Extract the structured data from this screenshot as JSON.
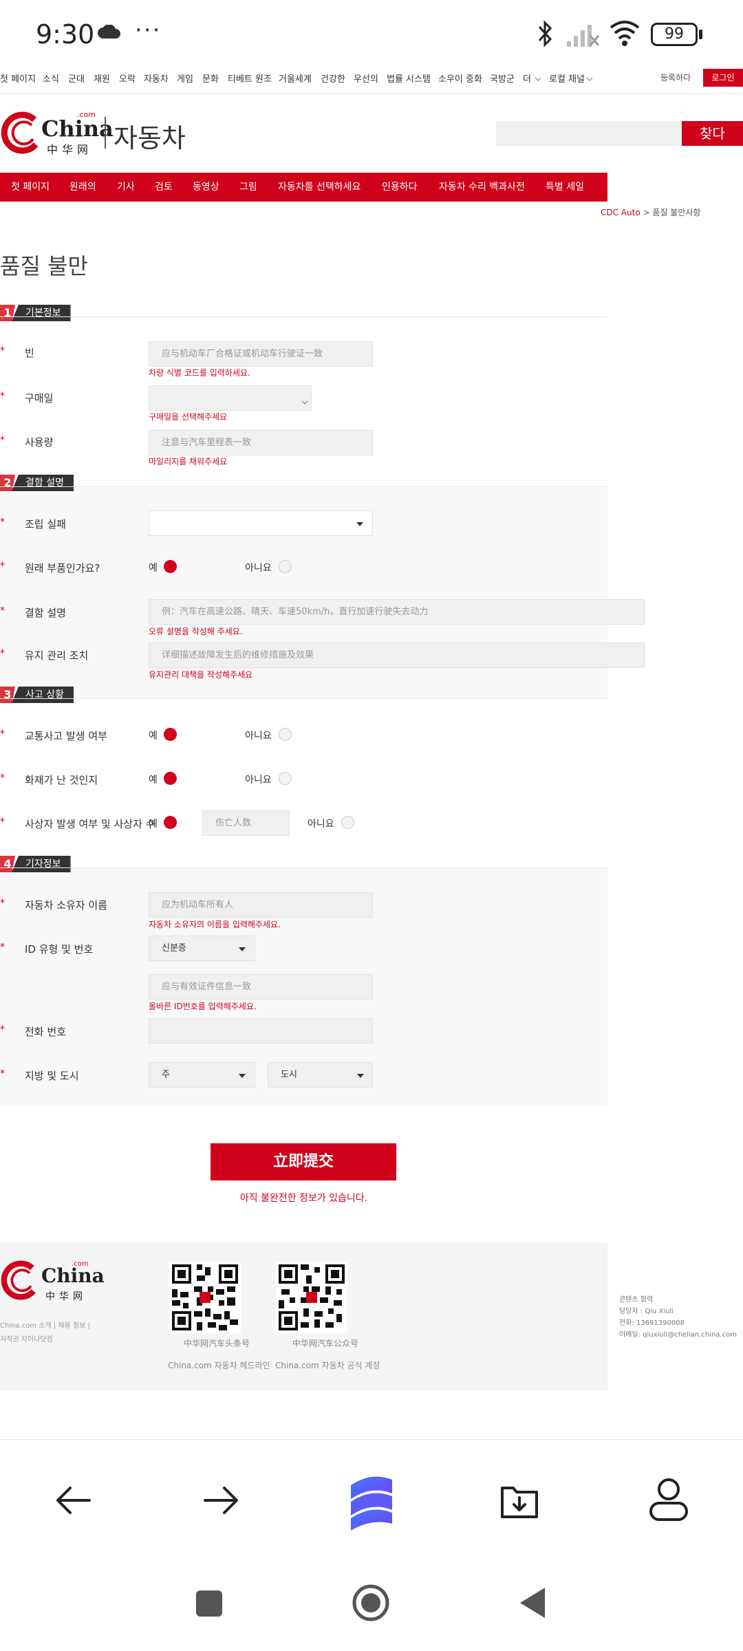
{
  "status_bar": {
    "time": "9:30",
    "more": "···",
    "battery": "99"
  },
  "top_nav": {
    "items": [
      "첫 페이지",
      "소식",
      "군대",
      "재원",
      "오락",
      "자동차",
      "게임",
      "문화",
      "티베트 원조",
      "거울세계",
      "건강한",
      "우선의",
      "법률 시스템",
      "소우이 중화",
      "국방군",
      "더",
      "로컬 채널"
    ],
    "register": "등록하다",
    "login": "로그인"
  },
  "logo": {
    "com": ".com",
    "china": "China",
    "zh": "中华网",
    "section": "자동차"
  },
  "search": {
    "placeholder": "",
    "button": "찾다"
  },
  "main_nav": [
    "첫 페이지",
    "원래의",
    "기사",
    "검토",
    "동영상",
    "그림",
    "자동차를 선택하세요",
    "인용하다",
    "자동차 수리 백과사전",
    "특별 세일"
  ],
  "breadcrumb": {
    "root": "CDC Auto",
    "sep": ">",
    "current": "품질 불만사항"
  },
  "page_title": "품질 불만",
  "section1": {
    "num": "1",
    "title": "기본정보",
    "vin_label": "빈",
    "vin_placeholder": "应与机动车厂合格证或机动车行驶证一致",
    "vin_error": "차량 식별 코드를 입력하세요.",
    "date_label": "구매일",
    "date_error": "구매일을 선택해주세요",
    "mileage_label": "사용량",
    "mileage_placeholder": "注意与汽车里程表一致",
    "mileage_error": "마일리지를 채워주세요"
  },
  "section2": {
    "num": "2",
    "title": "결함 설명",
    "assembly_label": "조립 실패",
    "original_label": "원래 부품인가요?",
    "yes": "예",
    "no": "아니요",
    "defect_label": "결함 설명",
    "defect_placeholder": "例：汽车在高速公路、晴天、车速50km/h，直行加速行驶失去动力",
    "defect_error": "오류 설명을 작성해 주세요.",
    "maint_label": "유지 관리 조치",
    "maint_placeholder": "详细描述故障发生后的维修措施及效果",
    "maint_error": "유지관리 대책을 작성해주세요"
  },
  "section3": {
    "num": "3",
    "title": "사고 상황",
    "traffic_label": "교통사고 발생 여부",
    "fire_label": "화재가 난 것인지",
    "casualty_label": "사상자 발생 여부 및 사상자 수",
    "yes": "예",
    "no": "아니요",
    "casualty_placeholder": "伤亡人数"
  },
  "section4": {
    "num": "4",
    "title": "기자정보",
    "owner_label": "자동차 소유자 이름",
    "owner_placeholder": "应为机动车所有人",
    "owner_error": "자동차 소유자의 이름을 입력해주세요.",
    "id_label": "ID 유형 및 번호",
    "id_type": "신분증",
    "id_placeholder": "应与有效证件信息一致",
    "id_error": "올바른 ID번호를 입력해주세요.",
    "phone_label": "전화 번호",
    "region_label": "지방 및 도시",
    "province": "주",
    "city": "도시"
  },
  "submit": {
    "label": "立即提交",
    "message": "아직 불완전한 정보가 있습니다."
  },
  "footer": {
    "links": "China.com  소개  |  채용  정보  |",
    "copyright": "저작권 차이나닷컴",
    "qr1_caption": "中华网汽车头条号",
    "qr2_caption": "中华网汽车公众号",
    "headline_link": "China.com 자동차 헤드라인",
    "official_link": "China.com 자동차 공식 계정",
    "contact_title": "콘텐츠 협력",
    "contact_person": "담당자 : Qiu Xiuli",
    "contact_phone": "전화: 13691390008",
    "contact_email": "이메일: qiuxiuli@chelian.china.com"
  },
  "colors": {
    "brand_red": "#d0021b",
    "dark_label": "#333333"
  }
}
